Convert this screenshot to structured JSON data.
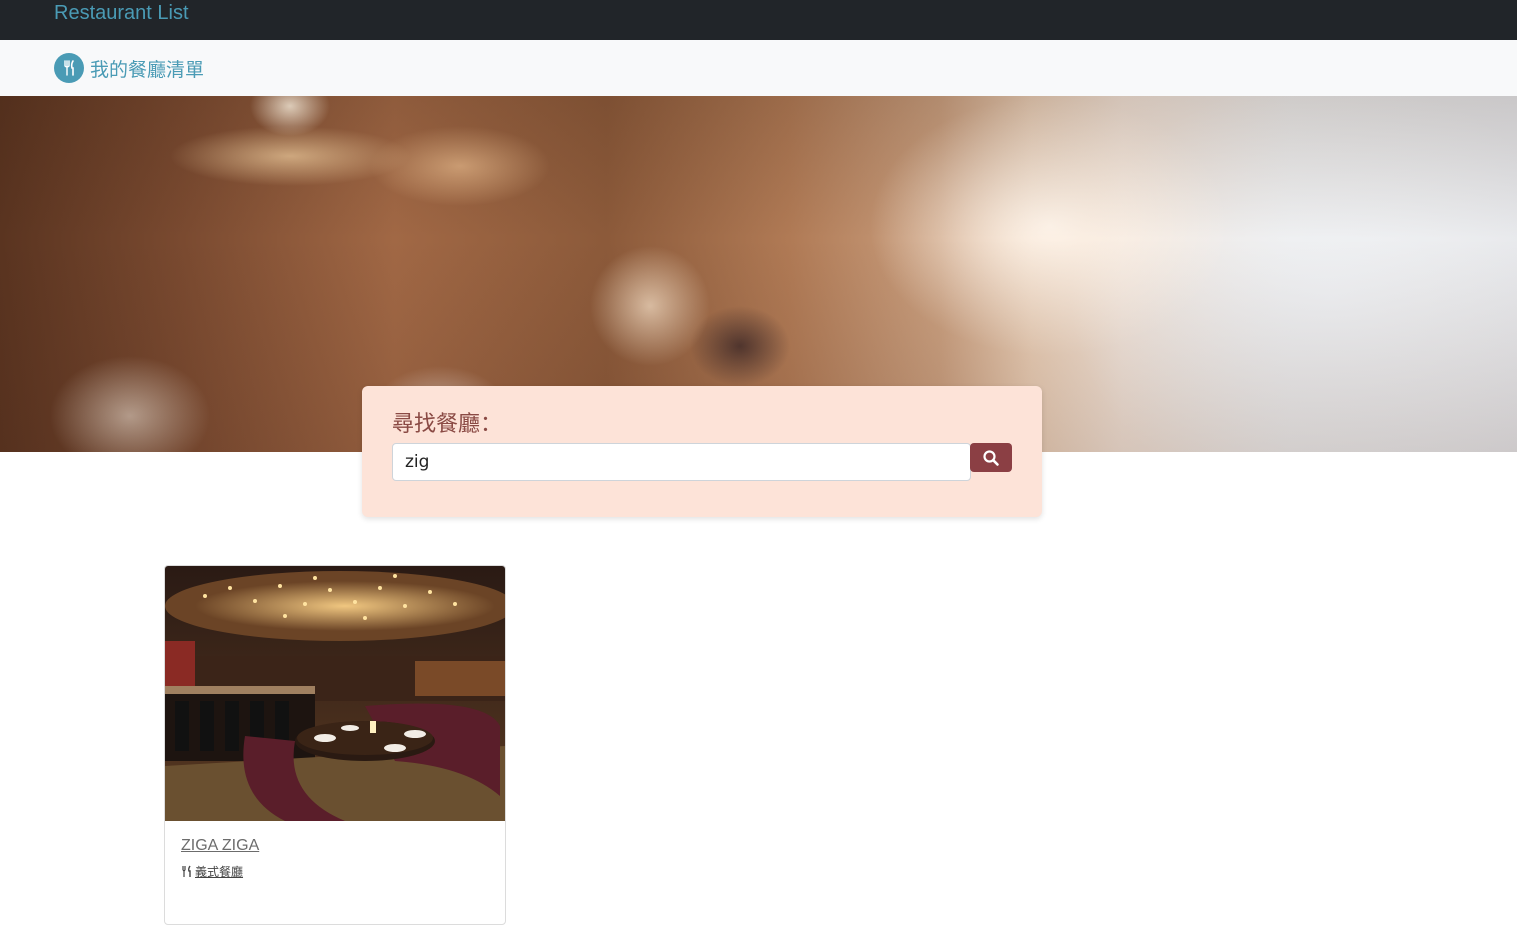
{
  "topbar": {
    "title": "Restaurant List"
  },
  "navbar": {
    "brand_label": "我的餐廳清單",
    "brand_icon": "utensils-icon"
  },
  "search": {
    "heading": "尋找餐廳：",
    "query": "zig",
    "button_icon": "search-icon"
  },
  "results": [
    {
      "name": "ZIGA ZIGA",
      "category": "義式餐廳",
      "category_icon": "utensils-icon"
    }
  ],
  "colors": {
    "topbar_bg": "#212529",
    "accent": "#4a9bb5",
    "search_card_bg": "#fde3d8",
    "search_button_bg": "#8b3f44"
  }
}
